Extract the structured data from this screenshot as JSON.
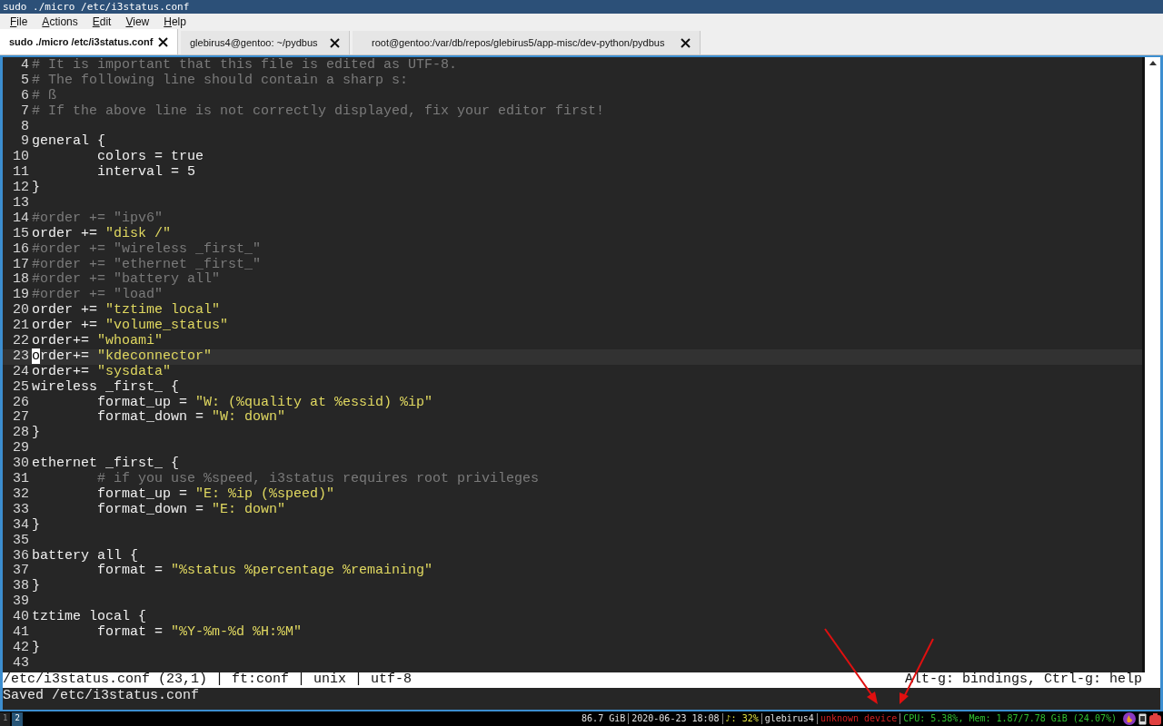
{
  "window": {
    "title": "sudo ./micro /etc/i3status.conf"
  },
  "menu": [
    "File",
    "Actions",
    "Edit",
    "View",
    "Help"
  ],
  "tabs": [
    {
      "label": "sudo ./micro /etc/i3status.conf",
      "selected": true
    },
    {
      "label": "glebirus4@gentoo: ~/pydbus",
      "selected": false
    },
    {
      "label": "root@gentoo:/var/db/repos/glebirus5/app-misc/dev-python/pydbus",
      "selected": false
    }
  ],
  "editor": {
    "lines": [
      {
        "number": "4",
        "current": false,
        "segments": [
          {
            "kind": "comment",
            "text": "# It is important that this file is edited as UTF-8."
          }
        ]
      },
      {
        "number": "5",
        "current": false,
        "segments": [
          {
            "kind": "comment",
            "text": "# The following line should contain a sharp s:"
          }
        ]
      },
      {
        "number": "6",
        "current": false,
        "segments": [
          {
            "kind": "comment",
            "text": "# ß"
          }
        ]
      },
      {
        "number": "7",
        "current": false,
        "segments": [
          {
            "kind": "comment",
            "text": "# If the above line is not correctly displayed, fix your editor first!"
          }
        ]
      },
      {
        "number": "8",
        "current": false
      },
      {
        "number": "9",
        "current": false,
        "segments": [
          {
            "kind": "plain",
            "text": "general {"
          }
        ]
      },
      {
        "number": "10",
        "current": false,
        "segments": [
          {
            "kind": "plain",
            "text": "\tcolors = true"
          }
        ]
      },
      {
        "number": "11",
        "current": false,
        "segments": [
          {
            "kind": "plain",
            "text": "\tinterval = 5"
          }
        ]
      },
      {
        "number": "12",
        "current": false,
        "segments": [
          {
            "kind": "plain",
            "text": "}"
          }
        ]
      },
      {
        "number": "13",
        "current": false
      },
      {
        "number": "14",
        "current": false,
        "segments": [
          {
            "kind": "comment",
            "text": "#order += \"ipv6\""
          }
        ]
      },
      {
        "number": "15",
        "current": false,
        "segments": [
          {
            "kind": "plain",
            "text": "order += "
          },
          {
            "kind": "string",
            "text": "\"disk /\""
          }
        ]
      },
      {
        "number": "16",
        "current": false,
        "segments": [
          {
            "kind": "comment",
            "text": "#order += \"wireless _first_\""
          }
        ]
      },
      {
        "number": "17",
        "current": false,
        "segments": [
          {
            "kind": "comment",
            "text": "#order += \"ethernet _first_\""
          }
        ]
      },
      {
        "number": "18",
        "current": false,
        "segments": [
          {
            "kind": "comment",
            "text": "#order += \"battery all\""
          }
        ]
      },
      {
        "number": "19",
        "current": false,
        "segments": [
          {
            "kind": "comment",
            "text": "#order += \"load\""
          }
        ]
      },
      {
        "number": "20",
        "current": false,
        "segments": [
          {
            "kind": "plain",
            "text": "order += "
          },
          {
            "kind": "string",
            "text": "\"tztime local\""
          }
        ]
      },
      {
        "number": "21",
        "current": false,
        "segments": [
          {
            "kind": "plain",
            "text": "order += "
          },
          {
            "kind": "string",
            "text": "\"volume_status\""
          }
        ]
      },
      {
        "number": "22",
        "current": false,
        "segments": [
          {
            "kind": "plain",
            "text": "order+= "
          },
          {
            "kind": "string",
            "text": "\"whoami\""
          }
        ]
      },
      {
        "number": "23",
        "current": true,
        "segments": [
          {
            "kind": "plain",
            "text": "order+= "
          },
          {
            "kind": "string",
            "text": "\"kdeconnector\""
          }
        ]
      },
      {
        "number": "24",
        "current": false,
        "segments": [
          {
            "kind": "plain",
            "text": "order+= "
          },
          {
            "kind": "string",
            "text": "\"sysdata\""
          }
        ]
      },
      {
        "number": "25",
        "current": false,
        "segments": [
          {
            "kind": "plain",
            "text": "wireless _first_ {"
          }
        ]
      },
      {
        "number": "26",
        "current": false,
        "segments": [
          {
            "kind": "plain",
            "text": "\tformat_up = "
          },
          {
            "kind": "string",
            "text": "\"W: (%quality at %essid) %ip\""
          }
        ]
      },
      {
        "number": "27",
        "current": false,
        "segments": [
          {
            "kind": "plain",
            "text": "\tformat_down = "
          },
          {
            "kind": "string",
            "text": "\"W: down\""
          }
        ]
      },
      {
        "number": "28",
        "current": false,
        "segments": [
          {
            "kind": "plain",
            "text": "}"
          }
        ]
      },
      {
        "number": "29",
        "current": false
      },
      {
        "number": "30",
        "current": false,
        "segments": [
          {
            "kind": "plain",
            "text": "ethernet _first_ {"
          }
        ]
      },
      {
        "number": "31",
        "current": false,
        "segments": [
          {
            "kind": "comment",
            "text": "\t# if you use %speed, i3status requires root privileges"
          }
        ]
      },
      {
        "number": "32",
        "current": false,
        "segments": [
          {
            "kind": "plain",
            "text": "\tformat_up = "
          },
          {
            "kind": "string",
            "text": "\"E: %ip (%speed)\""
          }
        ]
      },
      {
        "number": "33",
        "current": false,
        "segments": [
          {
            "kind": "plain",
            "text": "\tformat_down = "
          },
          {
            "kind": "string",
            "text": "\"E: down\""
          }
        ]
      },
      {
        "number": "34",
        "current": false,
        "segments": [
          {
            "kind": "plain",
            "text": "}"
          }
        ]
      },
      {
        "number": "35",
        "current": false
      },
      {
        "number": "36",
        "current": false,
        "segments": [
          {
            "kind": "plain",
            "text": "battery all {"
          }
        ]
      },
      {
        "number": "37",
        "current": false,
        "segments": [
          {
            "kind": "plain",
            "text": "\tformat = "
          },
          {
            "kind": "string",
            "text": "\"%status %percentage %remaining\""
          }
        ]
      },
      {
        "number": "38",
        "current": false,
        "segments": [
          {
            "kind": "plain",
            "text": "}"
          }
        ]
      },
      {
        "number": "39",
        "current": false
      },
      {
        "number": "40",
        "current": false,
        "segments": [
          {
            "kind": "plain",
            "text": "tztime local {"
          }
        ]
      },
      {
        "number": "41",
        "current": false,
        "segments": [
          {
            "kind": "plain",
            "text": "\tformat = "
          },
          {
            "kind": "string",
            "text": "\"%Y-%m-%d %H:%M\""
          }
        ]
      },
      {
        "number": "42",
        "current": false,
        "segments": [
          {
            "kind": "plain",
            "text": "}"
          }
        ]
      },
      {
        "number": "43",
        "current": false
      }
    ],
    "status_line": {
      "left": "/etc/i3status.conf (23,1) | ft:conf | unix | utf-8",
      "right": "Alt-g: bindings, Ctrl-g: help"
    },
    "message": "Saved /etc/i3status.conf"
  },
  "bar": {
    "workspaces": [
      {
        "label": "1",
        "selected": false
      },
      {
        "label": "2",
        "selected": true
      }
    ],
    "blocks": [
      {
        "text": "86.7 GiB",
        "color": "#e0e0e0"
      },
      {
        "text": "2020-06-23 18:08",
        "color": "#e0e0e0"
      },
      {
        "text": "♪: 32%",
        "color": "#e0e040"
      },
      {
        "text": "glebirus4",
        "color": "#e0e0e0"
      },
      {
        "text": "unknown device",
        "color": "#d02020"
      },
      {
        "text": "CPU: 5.38%, Mem: 1.87/7.78 GiB (24.07%)",
        "color": "#30c030"
      }
    ]
  }
}
